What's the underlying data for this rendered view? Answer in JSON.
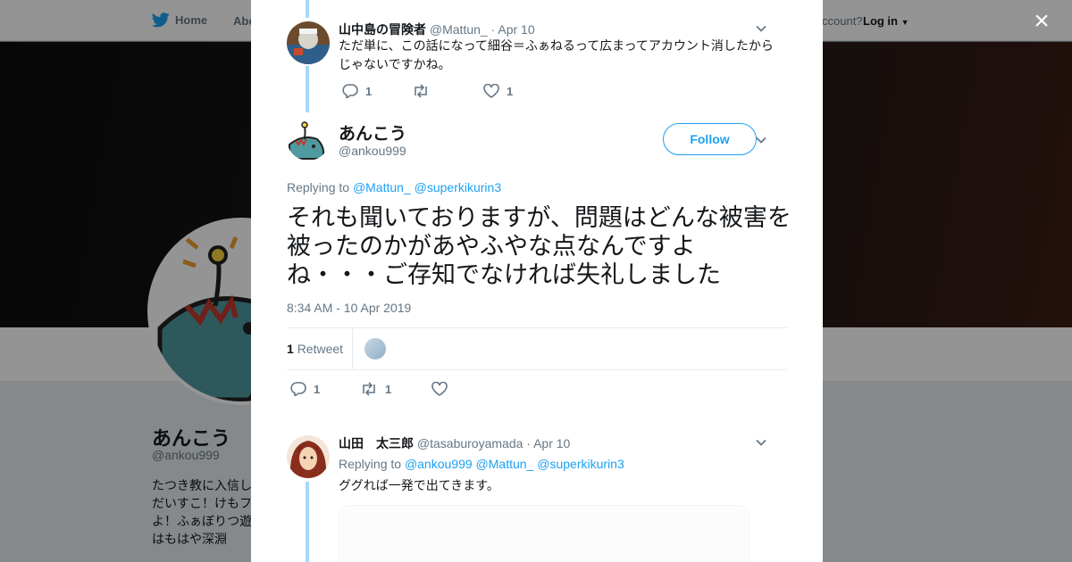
{
  "background": {
    "nav": {
      "home_label": "Home",
      "about_label": "Abo",
      "account_prompt": "ccount?",
      "login_label": "Log in"
    },
    "profile": {
      "name": "あんこう",
      "handle": "@ankou999",
      "bio_lines": [
        "たつき教に入信し",
        "だいすこ！けもフ",
        "よ！ふぁぼりつ遊",
        "はもはや深淵"
      ]
    },
    "close_label": "×"
  },
  "top_tweet": {
    "name": "山中島の冒険者",
    "handle": "@Mattun_",
    "date": "· Apr 10",
    "text": "ただ単に、この話になって細谷＝ふぁねるって広まってアカウント消したからじゃないですかね。",
    "reply_count": "1",
    "retweet_count": "",
    "like_count": "1"
  },
  "main_tweet": {
    "name": "あんこう",
    "handle": "@ankou999",
    "follow_label": "Follow",
    "replying_prefix": "Replying to",
    "replying_mentions": [
      "@Mattun_",
      "@superkikurin3"
    ],
    "text": "それも聞いておりますが、問題はどんな被害を被ったのかがあやふやな点なんですよね・・・ご存知でなければ失礼しました",
    "timestamp": "8:34 AM - 10 Apr 2019",
    "retweet_stat_count": "1",
    "retweet_stat_label": "Retweet",
    "reply_count": "1",
    "retweet_count": "1",
    "like_count": ""
  },
  "reply_tweet": {
    "name": "山田　太三郎",
    "handle": "@tasaburoyamada",
    "date": "· Apr 10",
    "replying_prefix": "Replying to",
    "replying_mentions": [
      "@ankou999",
      "@Mattun_",
      "@superkikurin3"
    ],
    "text": "ググれば一発で出てきます。"
  },
  "colors": {
    "accent": "#1da1f2",
    "thread_line": "#a4d9f9",
    "text_primary": "#14171a",
    "text_secondary": "#657786"
  }
}
